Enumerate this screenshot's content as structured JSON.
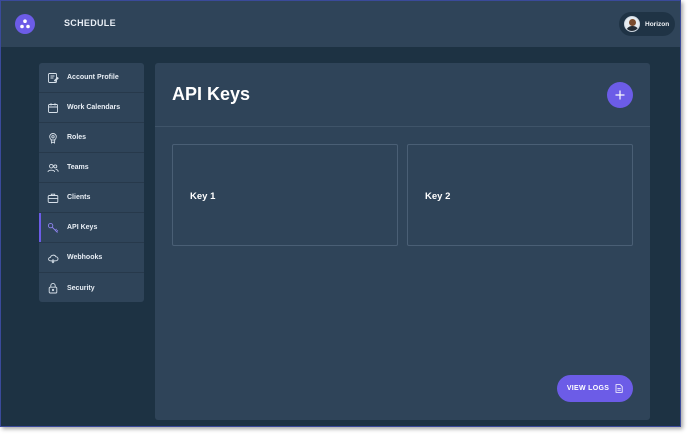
{
  "header": {
    "app_title": "SCHEDULE",
    "user_name": "Horizon"
  },
  "sidebar": {
    "items": [
      {
        "label": "Account Profile",
        "icon": "account-profile-icon"
      },
      {
        "label": "Work Calendars",
        "icon": "calendar-icon"
      },
      {
        "label": "Roles",
        "icon": "roles-icon"
      },
      {
        "label": "Teams",
        "icon": "teams-icon"
      },
      {
        "label": "Clients",
        "icon": "briefcase-icon"
      },
      {
        "label": "API Keys",
        "icon": "key-icon",
        "active": true
      },
      {
        "label": "Webhooks",
        "icon": "cloud-icon"
      },
      {
        "label": "Security",
        "icon": "lock-icon"
      }
    ]
  },
  "main": {
    "title": "API Keys",
    "keys": [
      {
        "label": "Key 1"
      },
      {
        "label": "Key 2"
      }
    ],
    "view_logs_label": "VIEW LOGS"
  },
  "colors": {
    "background": "#1d3243",
    "panel": "#2f4459",
    "accent": "#6c5ce7",
    "text": "#e8eef5"
  }
}
